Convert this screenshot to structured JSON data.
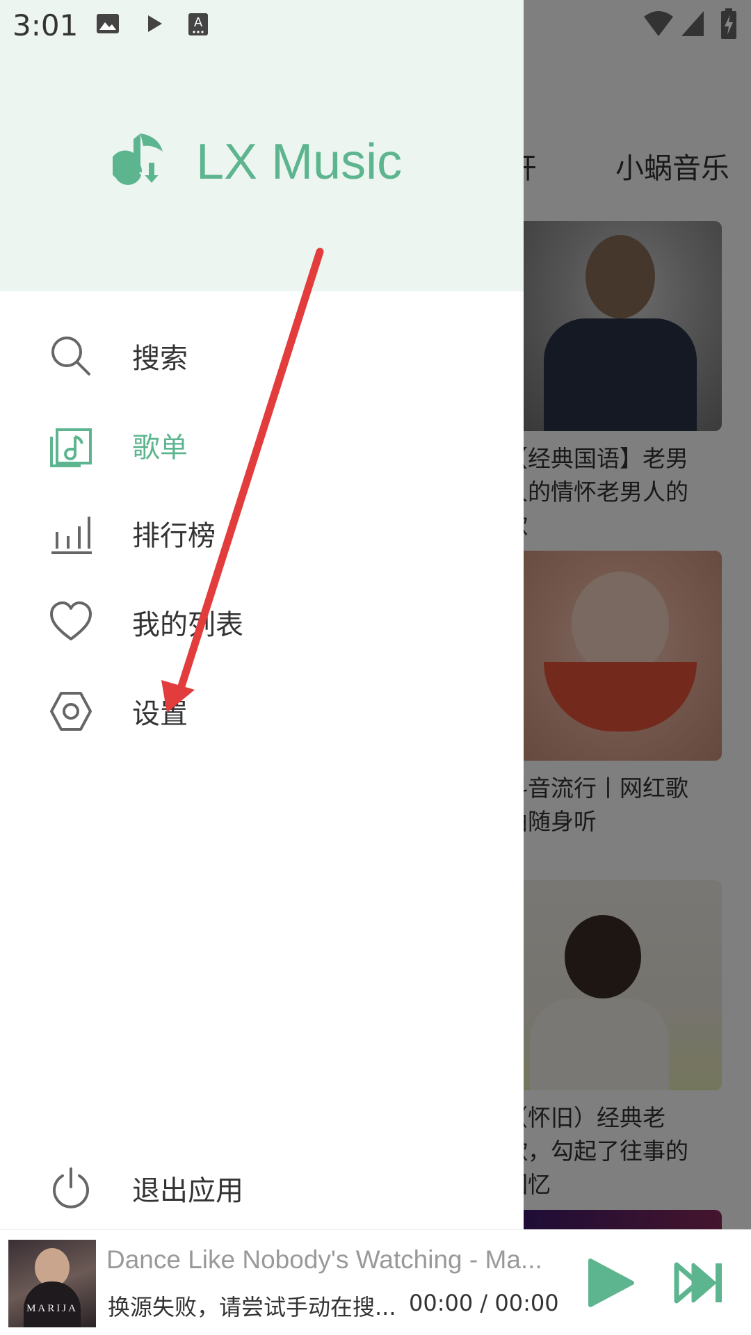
{
  "status_bar": {
    "time": "3:01",
    "left_icons": [
      "image-icon",
      "play-icon",
      "keyboard-a-icon"
    ],
    "right_icons": [
      "wifi-icon",
      "cell-signal-icon",
      "battery-charging-icon"
    ]
  },
  "drawer": {
    "app_name": "LX Music",
    "accent_color": "#5cb58f",
    "menu": {
      "search": "搜索",
      "songlist": "歌单",
      "rank": "排行榜",
      "mylist": "我的列表",
      "settings": "设置"
    },
    "exit_label": "退出应用"
  },
  "background": {
    "tabs": [
      "打开",
      "小蜗音乐"
    ],
    "cards": [
      {
        "title": "【经典国语】老男人的情怀老男人的歌"
      },
      {
        "title": "抖音流行丨网红歌曲随身听"
      },
      {
        "title": "（怀旧）经典老歌，勾起了往事的回忆"
      }
    ]
  },
  "player": {
    "cover_text": "MARIJA",
    "title": "Dance Like Nobody's Watching - Ma...",
    "status": "换源失败，请尝试手动在搜...",
    "time": "00:00 / 00:00"
  }
}
